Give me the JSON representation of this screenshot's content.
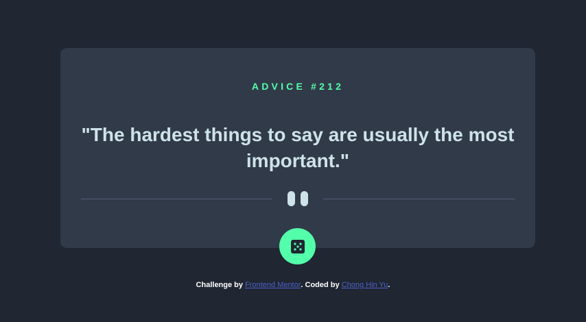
{
  "card": {
    "advice_label": "ADVICE #212",
    "quote": "\"The hardest things to say are usually the most important.\""
  },
  "dice_button": {
    "icon": "dice-icon"
  },
  "footer": {
    "challenge_prefix": "Challenge by ",
    "challenge_link": "Frontend Mentor",
    "coded_prefix": ". Coded by ",
    "author_link": "Chong Hin Yu",
    "suffix": "."
  },
  "colors": {
    "background": "#202632",
    "card": "#313a49",
    "accent": "#53ffaa",
    "text": "#cee3e9",
    "link": "#4a62c9"
  }
}
